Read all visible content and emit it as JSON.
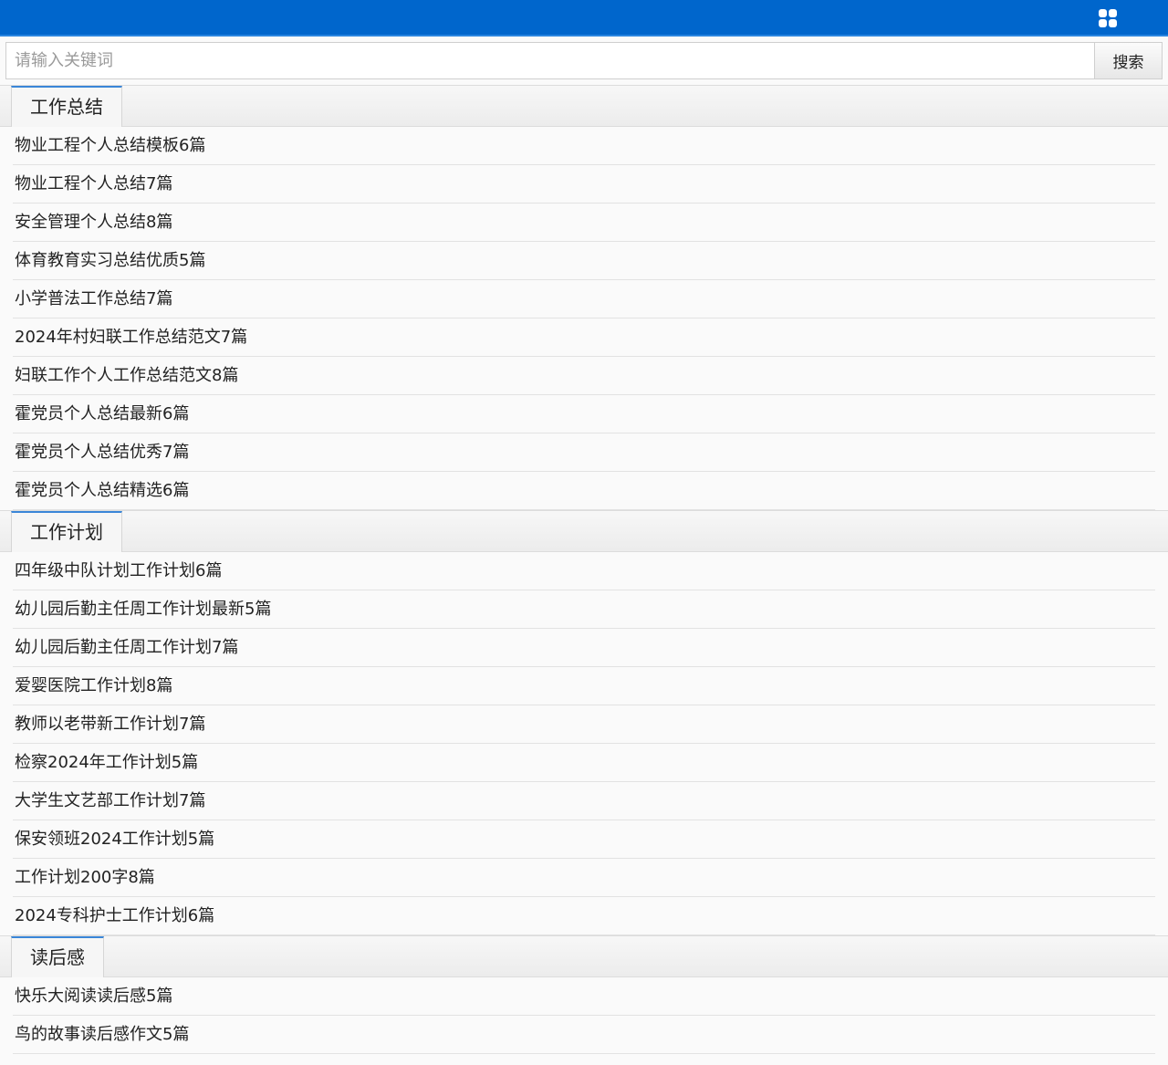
{
  "header": {
    "menu_icon": "grid-icon",
    "bar_color": "#0066cc"
  },
  "search": {
    "value": "",
    "placeholder": "请输入关键词",
    "button_label": "搜索"
  },
  "sections": [
    {
      "title": "工作总结",
      "items": [
        "物业工程个人总结模板6篇",
        "物业工程个人总结7篇",
        "安全管理个人总结8篇",
        "体育教育实习总结优质5篇",
        "小学普法工作总结7篇",
        "2024年村妇联工作总结范文7篇",
        "妇联工作个人工作总结范文8篇",
        "霍党员个人总结最新6篇",
        "霍党员个人总结优秀7篇",
        "霍党员个人总结精选6篇"
      ]
    },
    {
      "title": "工作计划",
      "items": [
        "四年级中队计划工作计划6篇",
        "幼儿园后勤主任周工作计划最新5篇",
        "幼儿园后勤主任周工作计划7篇",
        "爱婴医院工作计划8篇",
        "教师以老带新工作计划7篇",
        "检察2024年工作计划5篇",
        "大学生文艺部工作计划7篇",
        "保安领班2024工作计划5篇",
        "工作计划200字8篇",
        "2024专科护士工作计划6篇"
      ]
    },
    {
      "title": "读后感",
      "items": [
        "快乐大阅读读后感5篇",
        "鸟的故事读后感作文5篇"
      ]
    }
  ]
}
